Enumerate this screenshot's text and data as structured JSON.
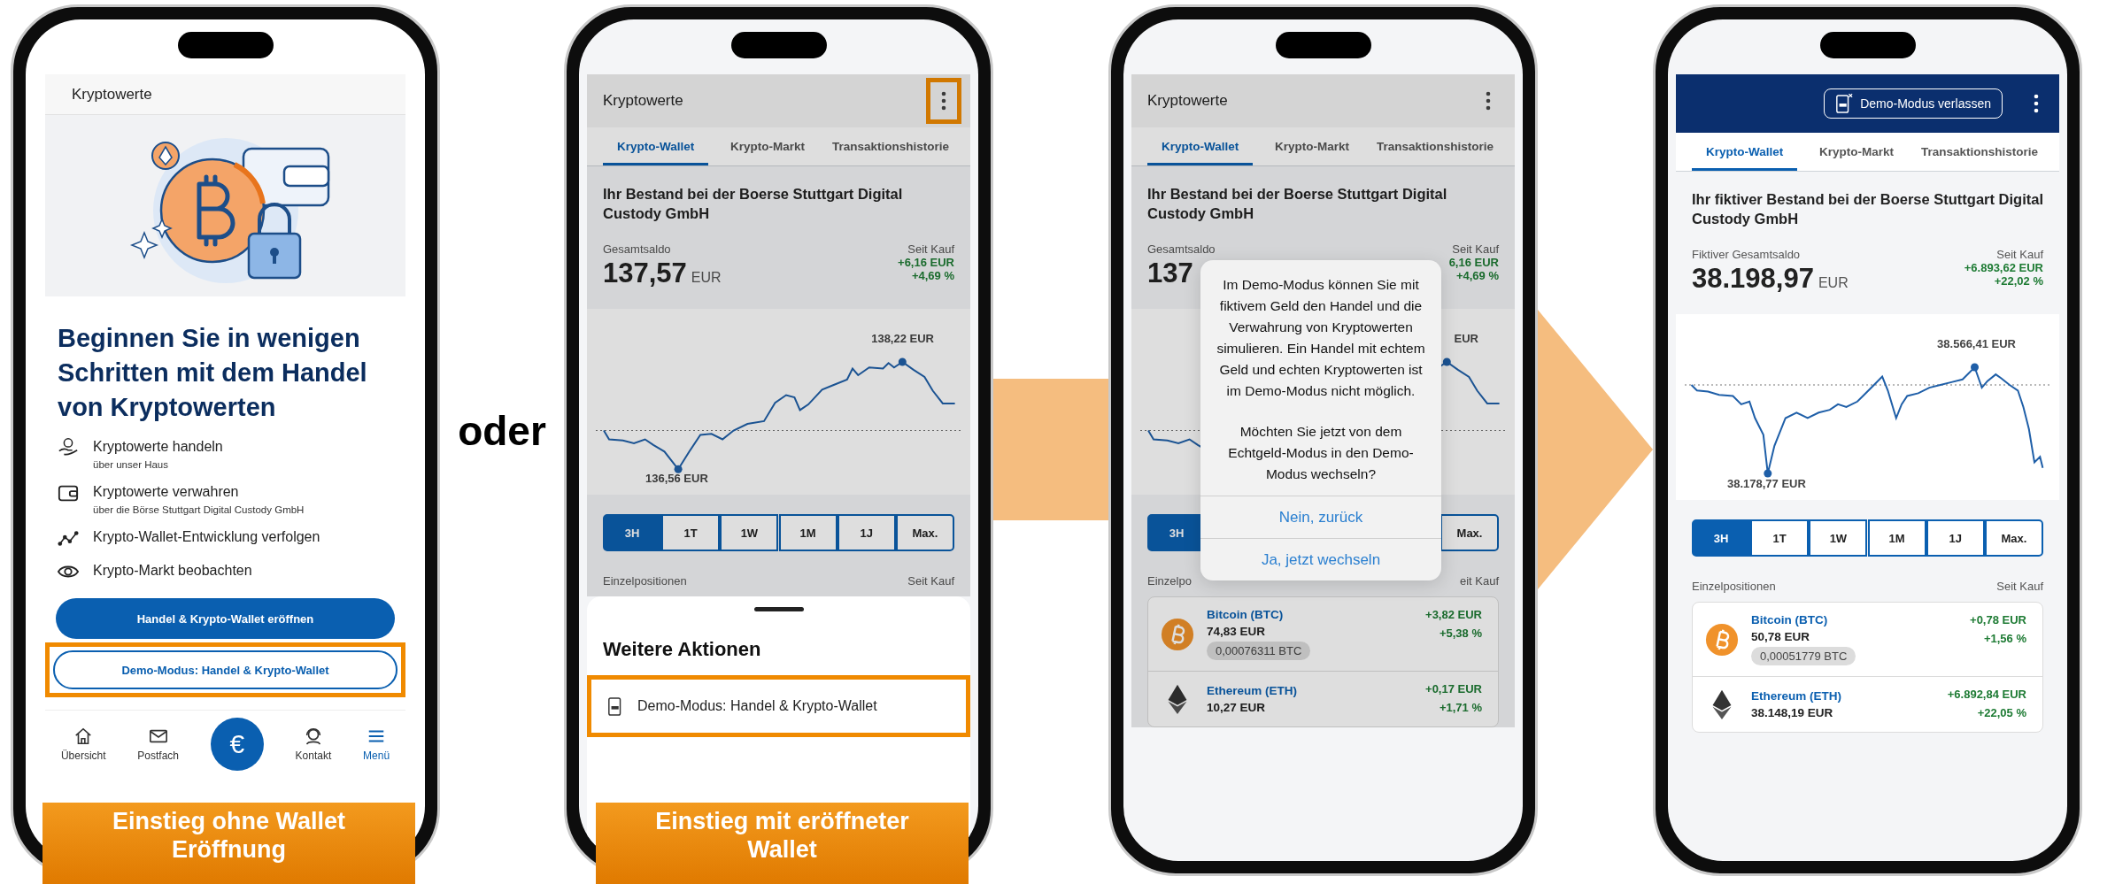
{
  "connector_text": "oder",
  "phones": [
    {
      "kind": "onboarding",
      "caption": "Einstieg ohne Wallet Eröffnung",
      "header_title": "Kryptowerte",
      "headline": "Beginnen Sie in wenigen Schritten mit dem Handel von Kryptowerten",
      "features": [
        {
          "kind": "trade",
          "title": "Kryptowerte handeln",
          "subtitle": "über unser Haus"
        },
        {
          "kind": "custody",
          "title": "Kryptowerte verwahren",
          "subtitle": "über die Börse Stuttgart Digital Custody GmbH"
        },
        {
          "kind": "track",
          "title": "Krypto-Wallet-Entwicklung verfolgen"
        },
        {
          "kind": "watch",
          "title": "Krypto-Markt beobachten"
        }
      ],
      "primary_button": "Handel & Krypto-Wallet eröffnen",
      "secondary_button": {
        "label": "Demo-Modus: Handel & Krypto-Wallet",
        "highlighted": true
      },
      "nav": [
        {
          "kind": "home",
          "label": "Übersicht",
          "selected": false
        },
        {
          "kind": "mail",
          "label": "Postfach",
          "selected": false
        },
        {
          "kind": "action",
          "label": "€",
          "selected": false
        },
        {
          "kind": "contact",
          "label": "Kontakt",
          "selected": false
        },
        {
          "kind": "menu",
          "label": "Menü",
          "selected": true
        }
      ]
    },
    {
      "kind": "wallet",
      "caption": "Einstieg mit eröffneter Wallet",
      "dimmed": true,
      "header": {
        "kind": "title",
        "title": "Kryptowerte"
      },
      "menu_highlighted": true,
      "tabs": [
        {
          "label": "Krypto-Wallet",
          "selected": true
        },
        {
          "label": "Krypto-Markt",
          "selected": false
        },
        {
          "label": "Transaktionshistorie",
          "selected": false
        }
      ],
      "holdings_title": "Ihr Bestand bei der Boerse Stuttgart Digital Custody GmbH",
      "balance_label": "Gesamtsaldo",
      "balance": "137,57",
      "currency": "EUR",
      "since_label": "Seit Kauf",
      "change_abs": "+6,16 EUR",
      "change_pct": "+4,69 %",
      "chart": {
        "kind": "real",
        "max_label": "138,22 EUR",
        "min_label": "136,56 EUR"
      },
      "ranges": [
        {
          "label": "3H",
          "selected": true
        },
        {
          "label": "1T",
          "selected": false
        },
        {
          "label": "1W",
          "selected": false
        },
        {
          "label": "1M",
          "selected": false
        },
        {
          "label": "1J",
          "selected": false
        },
        {
          "label": "Max.",
          "selected": false
        }
      ],
      "positions_label": "Einzelpositionen",
      "positions_since": "Seit Kauf",
      "sheet": {
        "title": "Weitere Aktionen",
        "items": [
          {
            "label": "Demo-Modus: Handel & Krypto-Wallet",
            "highlighted": true
          }
        ]
      }
    },
    {
      "kind": "wallet",
      "dimmed": true,
      "header": {
        "kind": "title",
        "title": "Kryptowerte"
      },
      "menu_highlighted": false,
      "tabs": [
        {
          "label": "Krypto-Wallet",
          "selected": true
        },
        {
          "label": "Krypto-Markt",
          "selected": false
        },
        {
          "label": "Transaktionshistorie",
          "selected": false
        }
      ],
      "holdings_title": "Ihr Bestand bei der Boerse Stuttgart Digital Custody GmbH",
      "balance_label": "Gesamtsaldo",
      "balance": "137",
      "since_label": "Seit Kauf",
      "change_abs": "6,16 EUR",
      "change_pct": "+4,69 %",
      "chart": {
        "kind": "real",
        "max_label": "EUR"
      },
      "ranges": [
        {
          "label": "3H",
          "selected": true
        },
        {
          "label": "Max.",
          "selected": false
        }
      ],
      "positions_label": "Einzelpo",
      "positions_since": "eit Kauf",
      "positions": [
        {
          "kind": "bitcoin",
          "name": "Bitcoin (BTC)",
          "value": "74,83 EUR",
          "amount": "0,00076311 BTC",
          "change_abs": "+3,82 EUR",
          "change_pct": "+5,38 %"
        },
        {
          "kind": "ethereum",
          "name": "Ethereum (ETH)",
          "value": "10,27 EUR",
          "change_abs": "+0,17 EUR",
          "change_pct": "+1,71 %"
        }
      ],
      "dialog": {
        "paragraphs": [
          "Im Demo-Modus können Sie mit fiktivem Geld den Handel und die Verwahrung von Kryptowerten simulieren. Ein Handel mit echtem Geld und echten Kryptowerten ist im Demo-Modus nicht möglich.",
          "Möchten Sie jetzt von dem Echtgeld-Modus in den Demo-Modus wechseln?"
        ],
        "buttons": [
          "Nein, zurück",
          "Ja, jetzt wechseln"
        ]
      }
    },
    {
      "kind": "wallet",
      "dimmed": false,
      "header": {
        "kind": "demo",
        "button": "Demo-Modus verlassen"
      },
      "menu_highlighted": false,
      "tabs": [
        {
          "label": "Krypto-Wallet",
          "selected": true
        },
        {
          "label": "Krypto-Markt",
          "selected": false
        },
        {
          "label": "Transaktionshistorie",
          "selected": false
        }
      ],
      "holdings_title": "Ihr fiktiver Bestand bei der Boerse Stuttgart Digital Custody GmbH",
      "balance_label": "Fiktiver Gesamtsaldo",
      "balance": "38.198,97",
      "currency": "EUR",
      "since_label": "Seit Kauf",
      "change_abs": "+6.893,62 EUR",
      "change_pct": "+22,02 %",
      "chart": {
        "kind": "demo",
        "max_label": "38.566,41 EUR",
        "min_label": "38.178,77 EUR"
      },
      "ranges": [
        {
          "label": "3H",
          "selected": true
        },
        {
          "label": "1T",
          "selected": false
        },
        {
          "label": "1W",
          "selected": false
        },
        {
          "label": "1M",
          "selected": false
        },
        {
          "label": "1J",
          "selected": false
        },
        {
          "label": "Max.",
          "selected": false
        }
      ],
      "positions_label": "Einzelpositionen",
      "positions_since": "Seit Kauf",
      "positions": [
        {
          "kind": "bitcoin",
          "name": "Bitcoin (BTC)",
          "value": "50,78 EUR",
          "amount": "0,00051779 BTC",
          "change_abs": "+0,78 EUR",
          "change_pct": "+1,56 %"
        },
        {
          "kind": "ethereum",
          "name": "Ethereum (ETH)",
          "value": "38.148,19 EUR",
          "change_abs": "+6.892,84 EUR",
          "change_pct": "+22,05 %"
        }
      ]
    }
  ]
}
